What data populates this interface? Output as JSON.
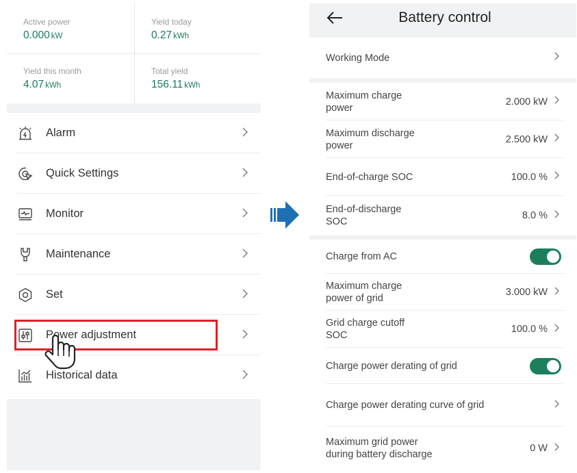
{
  "stats": {
    "active_power": {
      "label": "Active power",
      "value": "0.000",
      "unit": "kW"
    },
    "yield_today": {
      "label": "Yield today",
      "value": "0.27",
      "unit": "kWh"
    },
    "yield_month": {
      "label": "Yield this month",
      "value": "4.07",
      "unit": "kWh"
    },
    "total_yield": {
      "label": "Total yield",
      "value": "156.11",
      "unit": "kWh"
    }
  },
  "menu": {
    "items": [
      {
        "label": "Alarm",
        "icon": "alarm-icon"
      },
      {
        "label": "Quick Settings",
        "icon": "quick-settings-icon"
      },
      {
        "label": "Monitor",
        "icon": "monitor-icon"
      },
      {
        "label": "Maintenance",
        "icon": "maintenance-icon"
      },
      {
        "label": "Set",
        "icon": "set-icon"
      },
      {
        "label": "Power adjustment",
        "icon": "power-adjustment-icon"
      },
      {
        "label": "Historical data",
        "icon": "historical-data-icon"
      }
    ]
  },
  "battery": {
    "title": "Battery control",
    "working_mode": "Working Mode",
    "max_charge_power": {
      "label": "Maximum charge power",
      "value": "2.000 kW"
    },
    "max_discharge_power": {
      "label": "Maximum discharge power",
      "value": "2.500 kW"
    },
    "end_charge_soc": {
      "label": "End-of-charge SOC",
      "value": "100.0 %"
    },
    "end_discharge_soc": {
      "label": "End-of-discharge SOC",
      "value": "8.0 %"
    },
    "charge_from_ac": {
      "label": "Charge from AC",
      "on": true
    },
    "max_charge_power_grid": {
      "label": "Maximum charge power of grid",
      "value": "3.000 kW"
    },
    "grid_charge_cutoff": {
      "label": "Grid charge cutoff SOC",
      "value": "100.0 %"
    },
    "charge_power_derating": {
      "label": "Charge power derating of grid",
      "on": true
    },
    "derating_curve": {
      "label": "Charge power derating curve of grid"
    },
    "max_grid_power_discharge": {
      "label": "Maximum grid power during battery discharge",
      "value": "0 W"
    }
  },
  "colors": {
    "accent": "#1b7f5c",
    "highlight": "#e01f26",
    "arrow": "#1f6fb5"
  }
}
